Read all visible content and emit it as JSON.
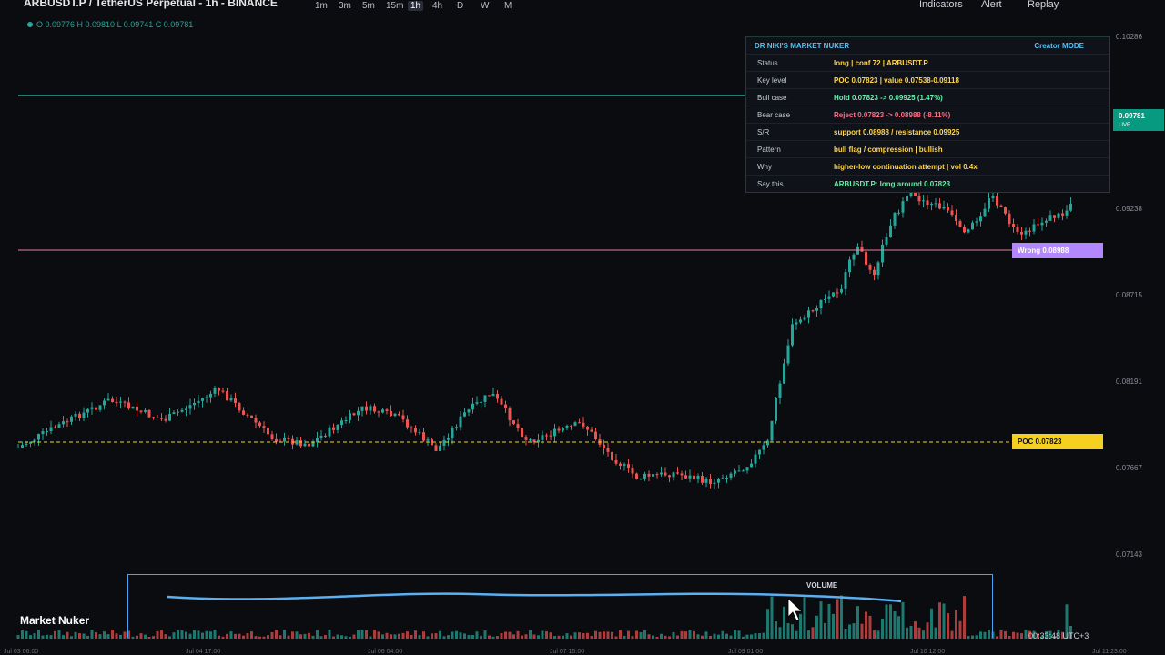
{
  "header": {
    "symbol_title": "ARBUSDT.P / TetherUS Perpetual - 1h - BINANCE",
    "timeframes": [
      "1m",
      "3m",
      "5m",
      "15m",
      "1h",
      "4h",
      "D",
      "W",
      "M"
    ],
    "active_timeframe": "1h",
    "indicators_label": "Indicators",
    "alert_label": "Alert",
    "replay_label": "Replay"
  },
  "ohlc": "O 0.09776 H 0.09810 L 0.09741 C 0.09781",
  "price_axis": [
    "0.10286",
    "0.09238",
    "0.08715",
    "0.08191",
    "0.07667",
    "0.07143"
  ],
  "live_price": {
    "value": "0.09781",
    "tag": "LIVE"
  },
  "levels": {
    "wrong_label": "Wrong 0.08988",
    "poc_label": "POC 0.07823"
  },
  "panel": {
    "title": "DR NIKI'S MARKET NUKER",
    "mode": "Creator MODE",
    "rows": [
      {
        "label": "Status",
        "value": "long | conf 72 | ARBUSDT.P",
        "color": "#ffd54f"
      },
      {
        "label": "Key level",
        "value": "POC 0.07823 | value 0.07538-0.09118",
        "color": "#ffd54f"
      },
      {
        "label": "Bull case",
        "value": "Hold 0.07823 -> 0.09925 (1.47%)",
        "color": "#69f0ae"
      },
      {
        "label": "Bear case",
        "value": "Reject 0.07823 -> 0.08988 (-8.11%)",
        "color": "#ff6b81"
      },
      {
        "label": "S/R",
        "value": "support 0.08988 / resistance 0.09925",
        "color": "#ffd54f"
      },
      {
        "label": "Pattern",
        "value": "bull flag / compression | bullish",
        "color": "#ffd54f"
      },
      {
        "label": "Why",
        "value": "higher-low continuation attempt | vol 0.4x",
        "color": "#ffd54f"
      },
      {
        "label": "Say this",
        "value": "ARBUSDT.P: long around 0.07823",
        "color": "#69f0ae"
      }
    ]
  },
  "date_axis": [
    "Jul 03 06:00",
    "Jul 04 17:00",
    "Jul 06 04:00",
    "Jul 07 15:00",
    "Jul 09 01:00",
    "Jul 10 12:00",
    "Jul 11 23:00"
  ],
  "volume_label": "VOLUME",
  "brand": "Market Nuker",
  "clock": "00:33:48 UTC+3",
  "colors": {
    "up": "#26a69a",
    "down": "#ef5350",
    "poc": "#f5d020",
    "wrong": "#b388ff",
    "live": "#089981"
  }
}
